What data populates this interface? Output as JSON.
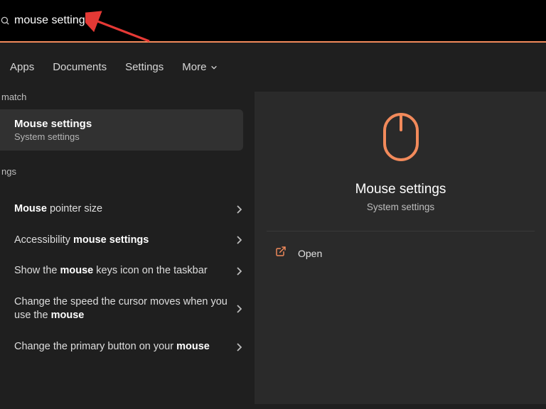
{
  "search": {
    "value": "mouse settings"
  },
  "tabs": {
    "apps": "Apps",
    "documents": "Documents",
    "settings": "Settings",
    "more": "More"
  },
  "left": {
    "best_match_header": "match",
    "best": {
      "title": "Mouse settings",
      "sub": "System settings"
    },
    "settings_header": "ngs",
    "items": [
      {
        "pre": "",
        "bold": "Mouse",
        "post": " pointer size"
      },
      {
        "pre": "Accessibility ",
        "bold": "mouse settings",
        "post": ""
      },
      {
        "pre": "Show the ",
        "bold": "mouse",
        "post": " keys icon on the taskbar"
      },
      {
        "pre": "Change the speed the cursor moves when you use the ",
        "bold": "mouse",
        "post": ""
      },
      {
        "pre": "Change the primary button on your ",
        "bold": "mouse",
        "post": ""
      }
    ]
  },
  "preview": {
    "title": "Mouse settings",
    "sub": "System settings",
    "open": "Open"
  }
}
